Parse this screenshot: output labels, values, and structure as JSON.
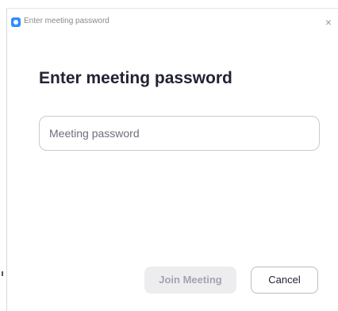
{
  "window": {
    "title": "Enter meeting password",
    "close_glyph": "×",
    "icon": "zoom-app-icon"
  },
  "dialog": {
    "heading": "Enter meeting password",
    "password_placeholder": "Meeting password",
    "password_value": ""
  },
  "actions": {
    "join_label": "Join Meeting",
    "cancel_label": "Cancel"
  },
  "colors": {
    "accent": "#2d8cff",
    "heading": "#232333",
    "disabled_bg": "#ededf0",
    "disabled_text": "#a3a3ae"
  }
}
